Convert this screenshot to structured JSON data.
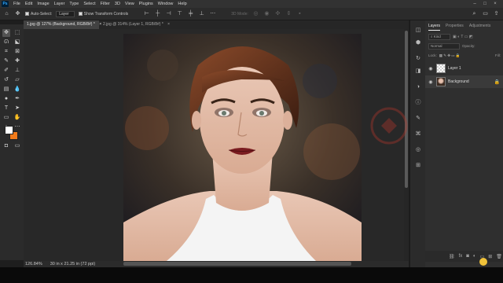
{
  "menubar": {
    "logo": "Ps",
    "items": [
      "File",
      "Edit",
      "Image",
      "Layer",
      "Type",
      "Select",
      "Filter",
      "3D",
      "View",
      "Plugins",
      "Window",
      "Help"
    ]
  },
  "options_bar": {
    "auto_select_label": "Auto-Select:",
    "auto_select_value": "Layer",
    "transform_controls_label": "Show Transform Controls",
    "mode_3d": "3D Mode:"
  },
  "tabs": [
    {
      "label": "1.jpg @ 127% (Background, RGB/8#) *",
      "close": "×"
    },
    {
      "label": "2.jpg @ 314% (Layer 1, RGB/8#) *",
      "close": "×"
    }
  ],
  "status_bar": {
    "zoom": "126.84%",
    "doc_info": "30 in x 21.25 in (72 ppi)"
  },
  "panel": {
    "tabs": [
      "Layers",
      "Properties",
      "Adjustments"
    ],
    "filter_kind": "Kind",
    "blend_mode": "Normal",
    "opacity_label": "Opacity:",
    "lock_label": "Lock:",
    "fill_label": "Fill:",
    "layers": [
      {
        "name": "Layer 1",
        "selected": false
      },
      {
        "name": "Background",
        "selected": true,
        "locked": true
      }
    ]
  },
  "colors": {
    "foreground": "#ffffff",
    "background": "#f07a1a",
    "accent": "#31a8ff"
  },
  "icons": {
    "tools": [
      "move-icon",
      "marquee-icon",
      "lasso-icon",
      "object-select-icon",
      "crop-icon",
      "frame-icon",
      "eyedropper-icon",
      "healing-brush-icon",
      "brush-icon",
      "clone-stamp-icon",
      "history-brush-icon",
      "eraser-icon",
      "gradient-icon",
      "blur-icon",
      "dodge-icon",
      "pen-icon",
      "type-icon",
      "path-select-icon",
      "rectangle-icon",
      "hand-icon",
      "zoom-icon"
    ]
  }
}
